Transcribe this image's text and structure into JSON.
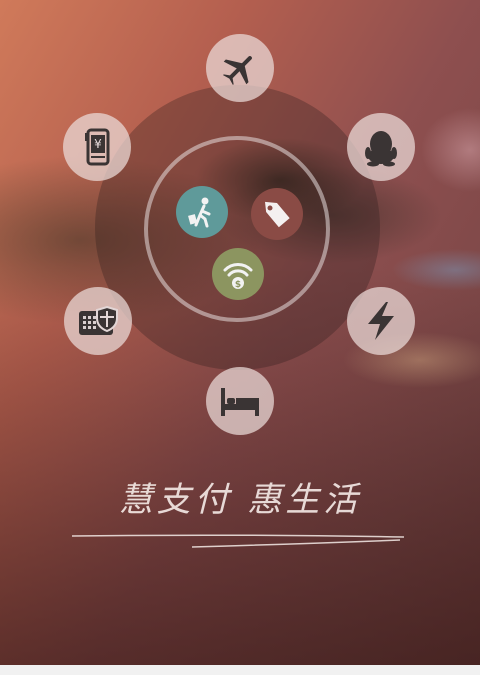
{
  "slogan": "慧支付 惠生活",
  "icons": {
    "top": "airplane-icon",
    "top_left": "mobile-payment-icon",
    "top_right": "qq-penguin-icon",
    "left": "card-security-icon",
    "right": "lightning-icon",
    "bottom": "bed-icon",
    "center_1": "traveler-luggage-icon",
    "center_2": "price-tag-icon",
    "center_3": "wifi-dollar-icon"
  },
  "colors": {
    "icon_dark": "#3a3434",
    "teal": "#5f9a9a",
    "tag_brown": "#8a4b45",
    "olive": "#8c9560",
    "text": "#f2e8e5"
  }
}
